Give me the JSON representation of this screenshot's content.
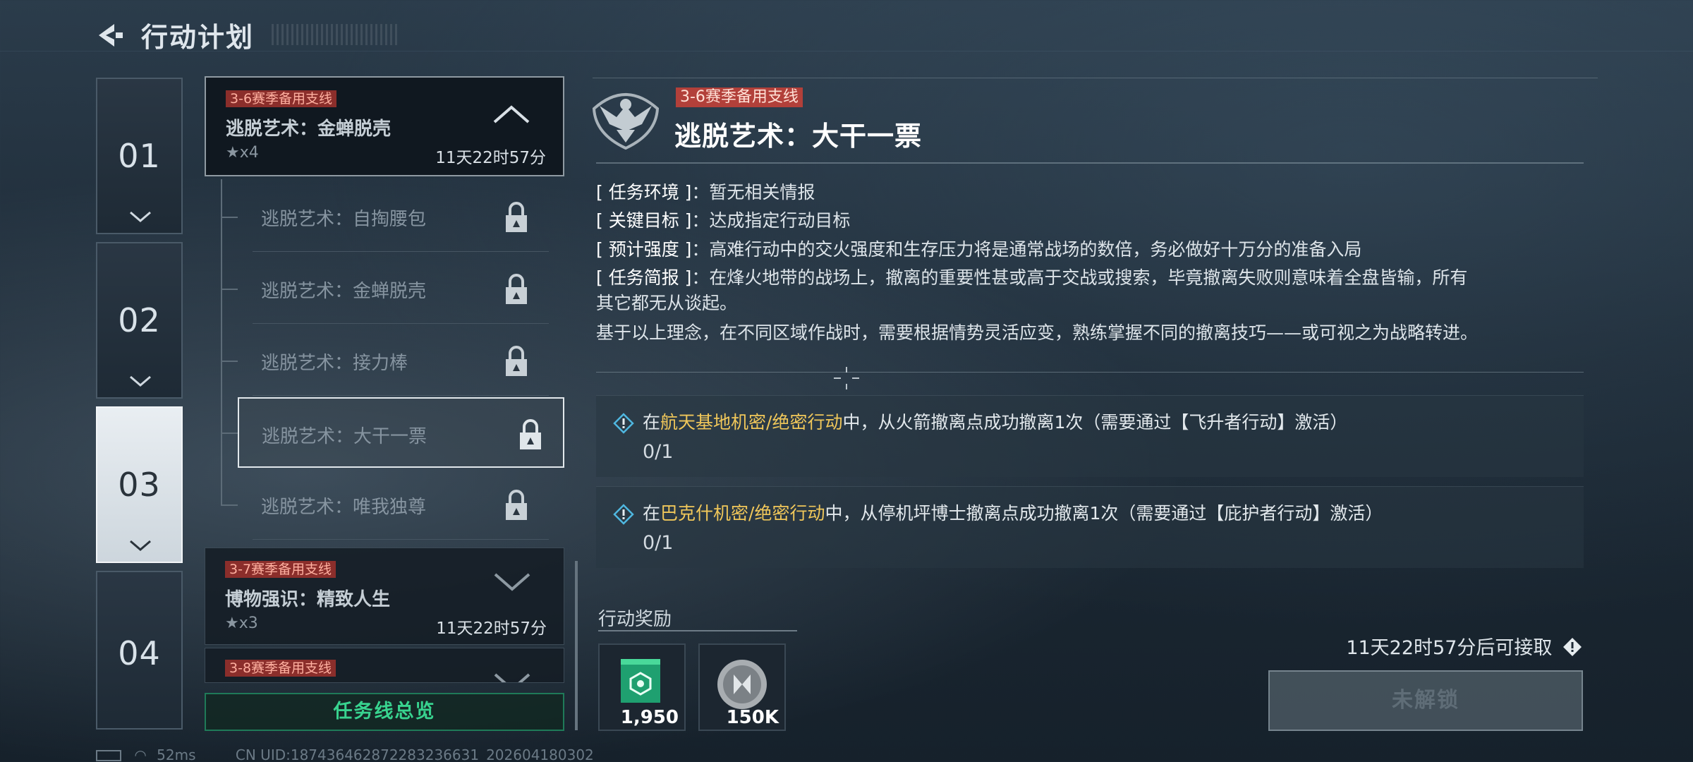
{
  "header": {
    "title": "行动计划"
  },
  "chapters": [
    {
      "number": "01"
    },
    {
      "number": "02"
    },
    {
      "number": "03",
      "active": true
    },
    {
      "number": "04"
    }
  ],
  "missions": {
    "open": {
      "tag": "3-6赛季备用支线",
      "title": "逃脱艺术：金蝉脱壳",
      "stars": "★x4",
      "timer": "11天22时57分",
      "sub_items": [
        {
          "label": "逃脱艺术：自掏腰包"
        },
        {
          "label": "逃脱艺术：金蝉脱壳"
        },
        {
          "label": "逃脱艺术：接力棒"
        },
        {
          "label": "逃脱艺术：大干一票"
        },
        {
          "label": "逃脱艺术：唯我独尊"
        }
      ]
    },
    "next": {
      "tag": "3-7赛季备用支线",
      "title": "博物强识：精致人生",
      "stars": "★x3",
      "timer": "11天22时57分"
    },
    "third": {
      "tag": "3-8赛季备用支线"
    },
    "overview_button": "任务线总览"
  },
  "detail": {
    "tag": "3-6赛季备用支线",
    "title": "逃脱艺术：大干一票",
    "info": [
      {
        "key": "[ 任务环境 ]",
        "value": "：暂无相关情报"
      },
      {
        "key": "[ 关键目标 ]",
        "value": "：达成指定行动目标"
      },
      {
        "key": "[ 预计强度 ]",
        "value": "：高难行动中的交火强度和生存压力将是通常战场的数倍，务必做好十万分的准备入局"
      },
      {
        "key": "[ 任务简报 ]",
        "value": "：在烽火地带的战场上，撤离的重要性甚或高于交战或搜索，毕竟撤离失败则意味着全盘皆输，所有"
      }
    ],
    "brief_cont": "其它都无从谈起。",
    "brief_para": "基于以上理念，在不同区域作战时，需要根据情势灵活应变，熟练掌握不同的撤离技巧——或可视之为战略转进。",
    "goals": [
      {
        "prefix": "在",
        "highlight": "航天基地机密/绝密行动",
        "suffix": "中，从火箭撤离点成功撤离1次（需要通过【飞升者行动】激活）",
        "progress": "0/1"
      },
      {
        "prefix": "在",
        "highlight": "巴克什机密/绝密行动",
        "suffix": "中，从停机坪博士撤离点成功撤离1次（需要通过【庇护者行动】激活）",
        "progress": "0/1"
      }
    ],
    "reward_label": "行动奖励",
    "rewards": [
      {
        "icon": "xp-card-icon",
        "qty": "1,950"
      },
      {
        "icon": "coin-icon",
        "qty": "150K"
      }
    ],
    "claim_time": "11天22时57分后可接取",
    "unlock_button": "未解锁"
  },
  "status_bar": {
    "ping": "52ms",
    "uid": "CN UID:187436462872283236631_202604180302"
  },
  "colors": {
    "accent_green": "#38d38f",
    "tag_red": "#b2403a",
    "highlight_gold": "#f0c75a"
  }
}
